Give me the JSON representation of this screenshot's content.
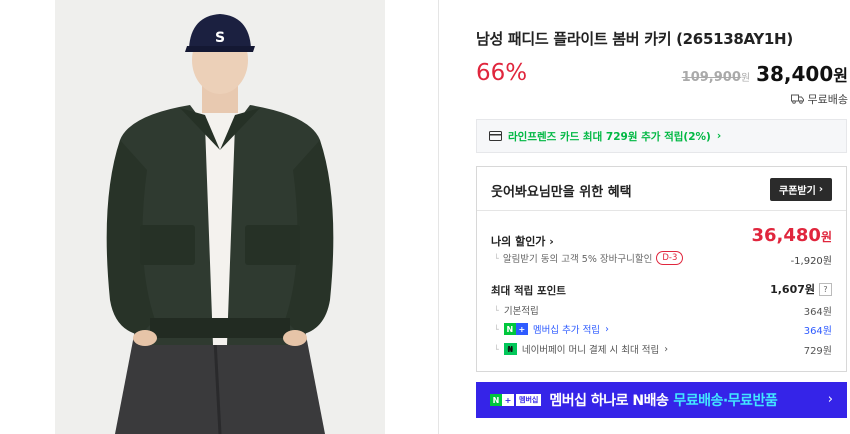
{
  "product": {
    "title": "남성 패디드 플라이트 봄버 카키 (265138AY1H)",
    "discount_rate": "66%",
    "original_price": "109,900",
    "original_unit": "원",
    "final_price": "38,400",
    "final_unit": "원",
    "shipping": "무료배송"
  },
  "card_promo": {
    "text": "라인프렌즈 카드 최대 729원 추가 적립(2%)",
    "chevron": "›"
  },
  "benefit": {
    "title": "웃어봐요님만을 위한 혜택",
    "coupon_button": "쿠폰받기",
    "my_discount_label": "나의 할인가",
    "my_discount_value": "36,480",
    "my_discount_unit": "원",
    "alert_text": "알림받기 동의 고객 5% 장바구니할인",
    "dday": "D-3",
    "alert_value": "-1,920원",
    "points_label": "최대 적립 포인트",
    "points_value": "1,607원",
    "help": "?",
    "basic_label": "기본적립",
    "basic_value": "364원",
    "membership_label": "멤버십 추가 적립",
    "membership_value": "364원",
    "npay_label": "네이버페이 머니 결제 시 최대 적립",
    "npay_value": "729원"
  },
  "banner": {
    "badge_n": "N",
    "badge_plus": "+",
    "badge_member": "멤버십",
    "text": "멤버십 하나로 N배송",
    "highlight": "무료배송·무료반품",
    "arrow": "›"
  },
  "colors": {
    "sale_red": "#e0263d",
    "naver_green": "#00b843",
    "banner_blue": "#3524e8",
    "link_blue": "#2e5bff"
  },
  "icons": [
    "truck-icon",
    "credit-card-icon",
    "chevron-right-icon",
    "help-icon",
    "naver-plus-icon",
    "naver-pay-icon"
  ]
}
